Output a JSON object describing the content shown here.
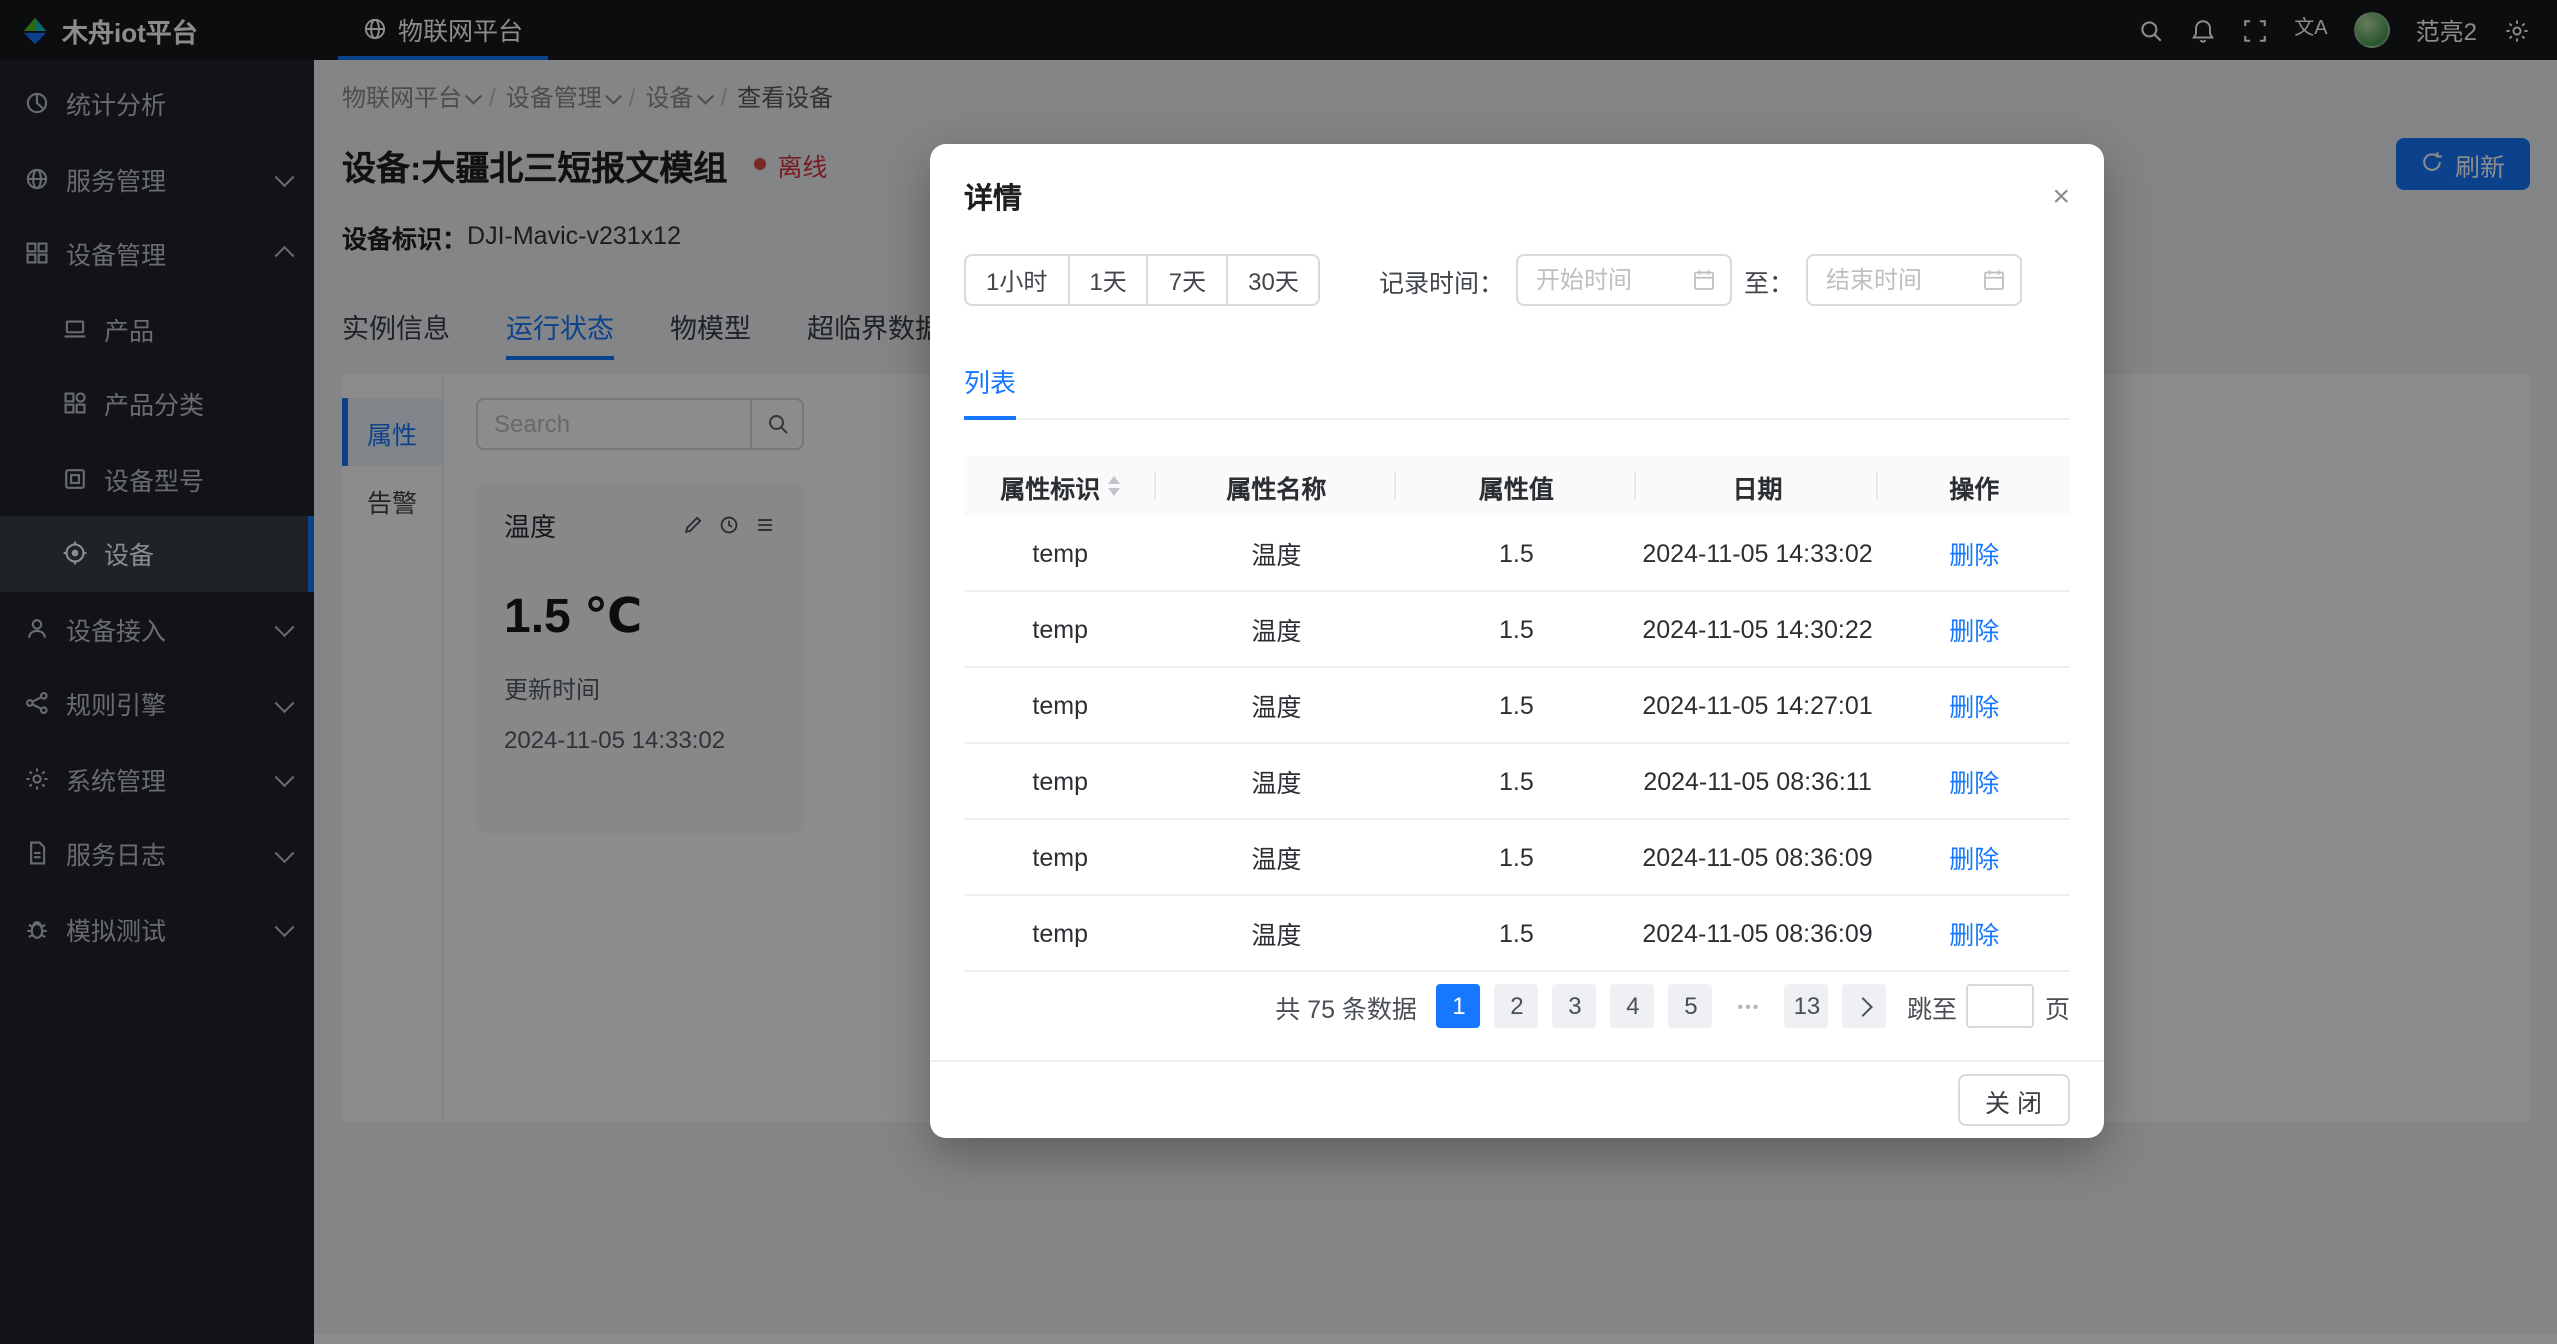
{
  "colors": {
    "accent": "#1677ff",
    "danger": "#f5222d",
    "header_bg": "#17191d",
    "sidebar_bg": "#212329"
  },
  "glyphs": {
    "close": "×",
    "translate": "文A",
    "breadcrumb_sep": "/"
  },
  "header": {
    "logo": "木舟iot平台",
    "nav_tab": "物联网平台",
    "username": "范亮2"
  },
  "sidebar": {
    "items": [
      {
        "label": "统计分析"
      },
      {
        "label": "服务管理"
      },
      {
        "label": "设备管理"
      },
      {
        "label": "产品"
      },
      {
        "label": "产品分类"
      },
      {
        "label": "设备型号"
      },
      {
        "label": "设备"
      },
      {
        "label": "设备接入"
      },
      {
        "label": "规则引擎"
      },
      {
        "label": "系统管理"
      },
      {
        "label": "服务日志"
      },
      {
        "label": "模拟测试"
      }
    ]
  },
  "breadcrumb": {
    "items": [
      "物联网平台",
      "设备管理",
      "设备",
      "查看设备"
    ]
  },
  "page": {
    "title": "设备:大疆北三短报文模组",
    "status": "离线",
    "device_label": "设备标识：",
    "device_id": "DJI-Mavic-v231x12",
    "refresh": "刷新",
    "tabs": [
      "实例信息",
      "运行状态",
      "物模型",
      "超临界数据"
    ],
    "active_tab": "运行状态",
    "side_tabs": [
      "属性",
      "告警"
    ],
    "search_placeholder": "Search",
    "card": {
      "title": "温度",
      "value": "1.5 ℃",
      "updated_label": "更新时间",
      "updated_time": "2024-11-05 14:33:02"
    }
  },
  "modal": {
    "title": "详情",
    "ranges": [
      "1小时",
      "1天",
      "7天",
      "30天"
    ],
    "record_label": "记录时间：",
    "start_placeholder": "开始时间",
    "to_label": "至：",
    "end_placeholder": "结束时间",
    "list_tab": "列表",
    "table": {
      "columns": [
        "属性标识",
        "属性名称",
        "属性值",
        "日期",
        "操作"
      ],
      "rows": [
        {
          "key": "temp",
          "name": "温度",
          "value": "1.5",
          "date": "2024-11-05 14:33:02",
          "action": "删除"
        },
        {
          "key": "temp",
          "name": "温度",
          "value": "1.5",
          "date": "2024-11-05 14:30:22",
          "action": "删除"
        },
        {
          "key": "temp",
          "name": "温度",
          "value": "1.5",
          "date": "2024-11-05 14:27:01",
          "action": "删除"
        },
        {
          "key": "temp",
          "name": "温度",
          "value": "1.5",
          "date": "2024-11-05 08:36:11",
          "action": "删除"
        },
        {
          "key": "temp",
          "name": "温度",
          "value": "1.5",
          "date": "2024-11-05 08:36:09",
          "action": "删除"
        },
        {
          "key": "temp",
          "name": "温度",
          "value": "1.5",
          "date": "2024-11-05 08:36:09",
          "action": "删除"
        }
      ]
    },
    "pagination": {
      "total": "共 75 条数据",
      "pages": [
        "1",
        "2",
        "3",
        "4",
        "5"
      ],
      "ellipsis": "•••",
      "last_page": "13",
      "active": "1",
      "jump_label": "跳至",
      "jump_suffix": "页"
    },
    "close_btn": "关 闭"
  }
}
